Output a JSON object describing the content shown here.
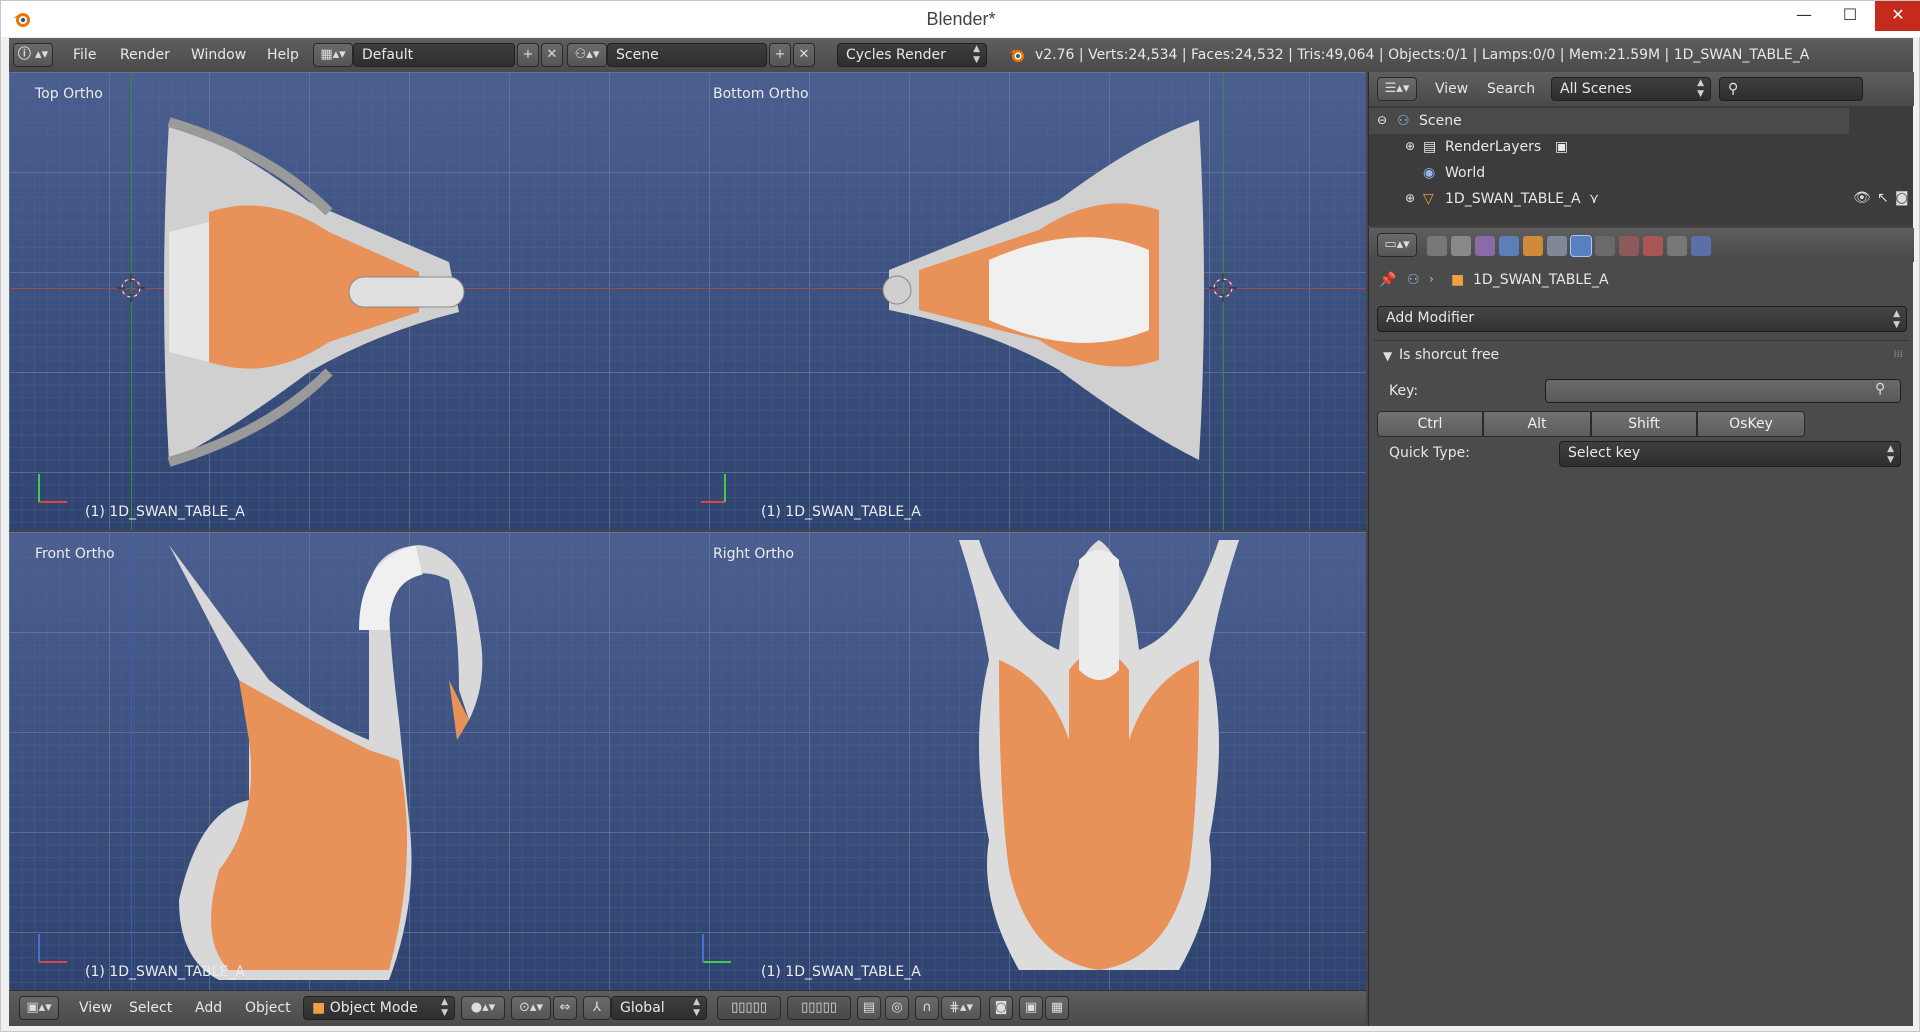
{
  "window": {
    "title": "Blender*",
    "minimize": "—",
    "maximize": "☐",
    "close": "✕"
  },
  "info_header": {
    "menus": [
      "File",
      "Render",
      "Window",
      "Help"
    ],
    "screen_layout": "Default",
    "scene": "Scene",
    "render_engine": "Cycles Render",
    "stats": "v2.76 | Verts:24,534 | Faces:24,532 | Tris:49,064 | Objects:0/1 | Lamps:0/0 | Mem:21.59M | 1D_SWAN_TABLE_A"
  },
  "viewports": [
    {
      "label": "Top Ortho",
      "object": "(1) 1D_SWAN_TABLE_A"
    },
    {
      "label": "Bottom Ortho",
      "object": "(1) 1D_SWAN_TABLE_A"
    },
    {
      "label": "Front Ortho",
      "object": "(1) 1D_SWAN_TABLE_A"
    },
    {
      "label": "Right Ortho",
      "object": "(1) 1D_SWAN_TABLE_A"
    }
  ],
  "view3d_header": {
    "menus": [
      "View",
      "Select",
      "Add",
      "Object"
    ],
    "mode": "Object Mode",
    "orientation": "Global"
  },
  "outliner": {
    "menus": [
      "View",
      "Search"
    ],
    "display_mode": "All Scenes",
    "items": [
      {
        "label": "Scene",
        "icon": "scene-icon"
      },
      {
        "label": "RenderLayers",
        "icon": "render-layers-icon"
      },
      {
        "label": "World",
        "icon": "world-icon"
      },
      {
        "label": "1D_SWAN_TABLE_A",
        "icon": "mesh-object-icon"
      }
    ]
  },
  "properties": {
    "context_object": "1D_SWAN_TABLE_A",
    "add_modifier": "Add Modifier",
    "panel_title": "Is shorcut free",
    "key_label": "Key:",
    "key_value": "",
    "modifiers": [
      "Ctrl",
      "Alt",
      "Shift",
      "OsKey"
    ],
    "quick_type_label": "Quick Type:",
    "quick_type_value": "Select key"
  },
  "colors": {
    "orange_feathers": "#e8925a",
    "white_feathers": "#dcdcdc",
    "viewport_bg": "#3d5383",
    "accent_blue": "#5680c2"
  }
}
